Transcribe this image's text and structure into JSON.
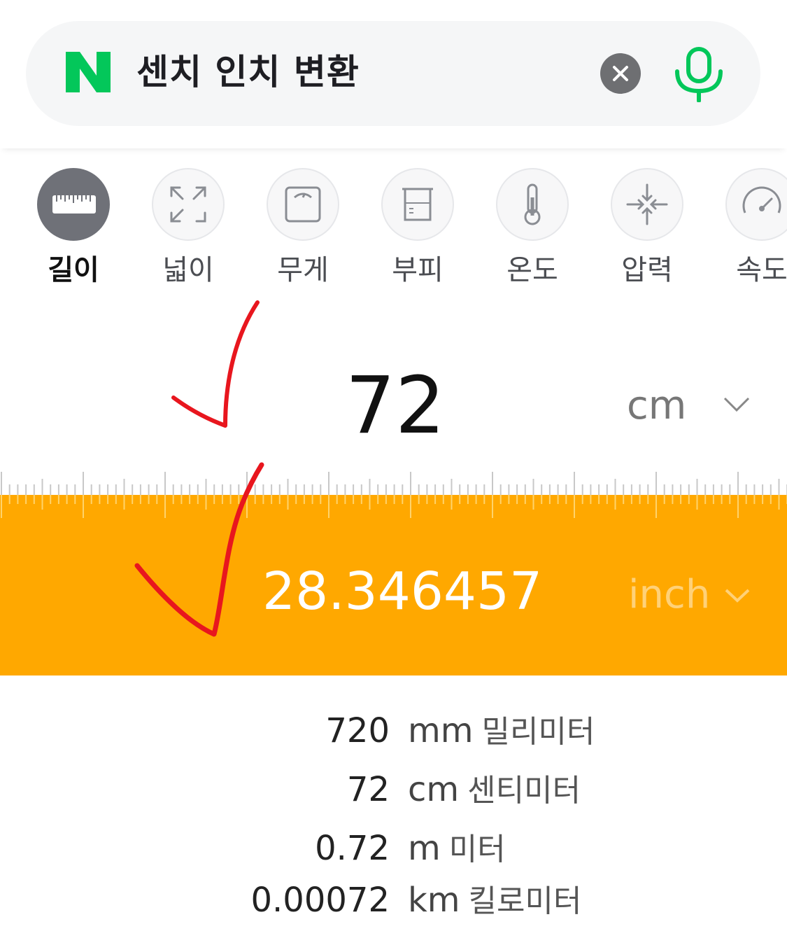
{
  "search": {
    "logo_letter": "N",
    "query": "센치 인치 변환",
    "brand_color": "#03c75a"
  },
  "categories": [
    {
      "label": "길이",
      "icon": "ruler-icon",
      "active": true
    },
    {
      "label": "넓이",
      "icon": "expand-icon",
      "active": false
    },
    {
      "label": "무게",
      "icon": "scale-icon",
      "active": false
    },
    {
      "label": "부피",
      "icon": "beaker-icon",
      "active": false
    },
    {
      "label": "온도",
      "icon": "thermometer-icon",
      "active": false
    },
    {
      "label": "압력",
      "icon": "compress-icon",
      "active": false
    },
    {
      "label": "속도",
      "icon": "speedometer-icon",
      "active": false
    }
  ],
  "converter": {
    "input_value": "72",
    "input_unit": "cm",
    "result_value": "28.346457",
    "result_unit": "inch",
    "accent_color": "#ffa800"
  },
  "conversions": [
    {
      "value": "720",
      "unit": "mm",
      "name": "밀리미터"
    },
    {
      "value": "72",
      "unit": "cm",
      "name": "센티미터"
    },
    {
      "value": "0.72",
      "unit": "m",
      "name": "미터"
    },
    {
      "value": "0.00072",
      "unit": "km",
      "name": "킬로미터"
    }
  ]
}
